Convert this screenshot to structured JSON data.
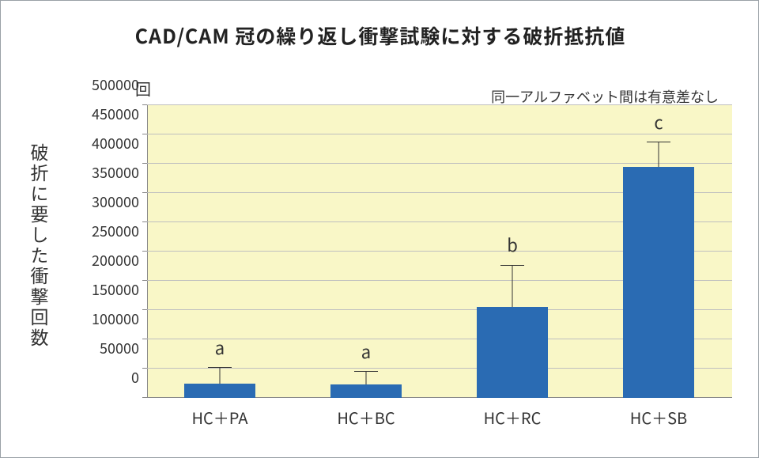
{
  "title": "CAD/CAM 冠の繰り返し衝撃試験に対する破折抵抗値",
  "note": "同一アルファベット間は有意差なし",
  "unit": "回",
  "ylabel": "破折に要した衝撃回数",
  "yticks": [
    "0",
    "50000",
    "100000",
    "150000",
    "200000",
    "250000",
    "300000",
    "350000",
    "400000",
    "450000",
    "500000"
  ],
  "xlabels": [
    "HC＋PA",
    "HC＋BC",
    "HC＋RC",
    "HC＋SB"
  ],
  "sig": [
    "a",
    "a",
    "b",
    "c"
  ],
  "chart_data": {
    "type": "bar",
    "title": "CAD/CAM 冠の繰り返し衝撃試験に対する破折抵抗値",
    "xlabel": "",
    "ylabel": "破折に要した衝撃回数",
    "y_unit": "回",
    "ylim": [
      0,
      500000
    ],
    "categories": [
      "HC+PA",
      "HC+BC",
      "HC+RC",
      "HC+SB"
    ],
    "values": [
      25000,
      23000,
      155000,
      395000
    ],
    "error_up": [
      27000,
      22000,
      70000,
      42000
    ],
    "significance_groups": [
      "a",
      "a",
      "b",
      "c"
    ],
    "note": "同一アルファベット間は有意差なし"
  }
}
